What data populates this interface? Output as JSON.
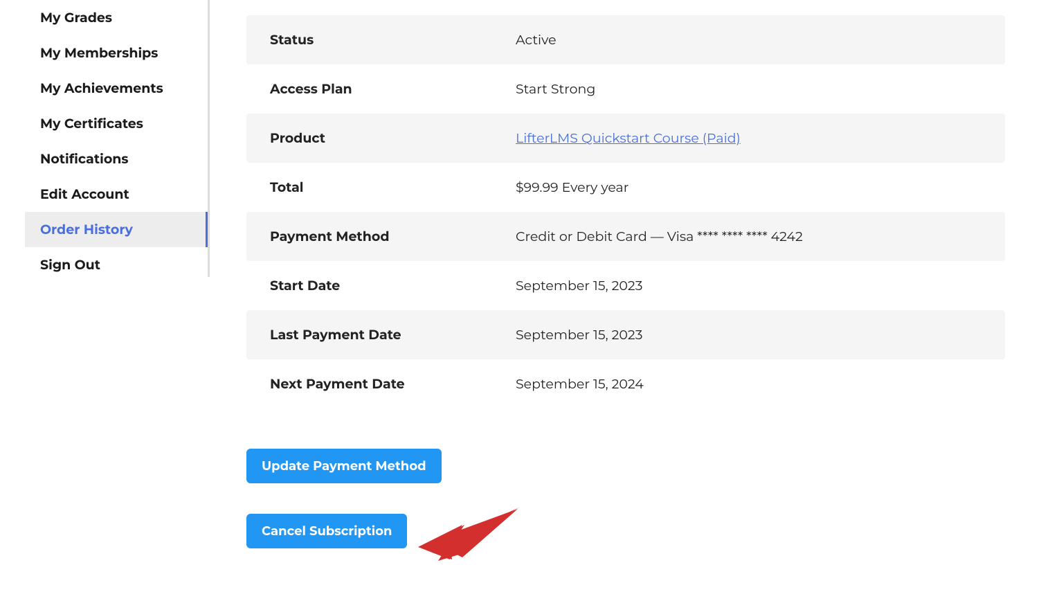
{
  "sidebar": {
    "items": [
      {
        "label": "My Grades",
        "active": false
      },
      {
        "label": "My Memberships",
        "active": false
      },
      {
        "label": "My Achievements",
        "active": false
      },
      {
        "label": "My Certificates",
        "active": false
      },
      {
        "label": "Notifications",
        "active": false
      },
      {
        "label": "Edit Account",
        "active": false
      },
      {
        "label": "Order History",
        "active": true
      },
      {
        "label": "Sign Out",
        "active": false
      }
    ]
  },
  "order": {
    "rows": [
      {
        "label": "Status",
        "value": "Active",
        "link": false
      },
      {
        "label": "Access Plan",
        "value": "Start Strong",
        "link": false
      },
      {
        "label": "Product",
        "value": "LifterLMS Quickstart Course (Paid)",
        "link": true
      },
      {
        "label": "Total",
        "value": "$99.99 Every year",
        "link": false
      },
      {
        "label": "Payment Method",
        "value": "Credit or Debit Card — Visa **** **** **** 4242",
        "link": false
      },
      {
        "label": "Start Date",
        "value": "September 15, 2023",
        "link": false
      },
      {
        "label": "Last Payment Date",
        "value": "September 15, 2023",
        "link": false
      },
      {
        "label": "Next Payment Date",
        "value": "September 15, 2024",
        "link": false
      }
    ]
  },
  "actions": {
    "update_payment": "Update Payment Method",
    "cancel_subscription": "Cancel Subscription"
  }
}
